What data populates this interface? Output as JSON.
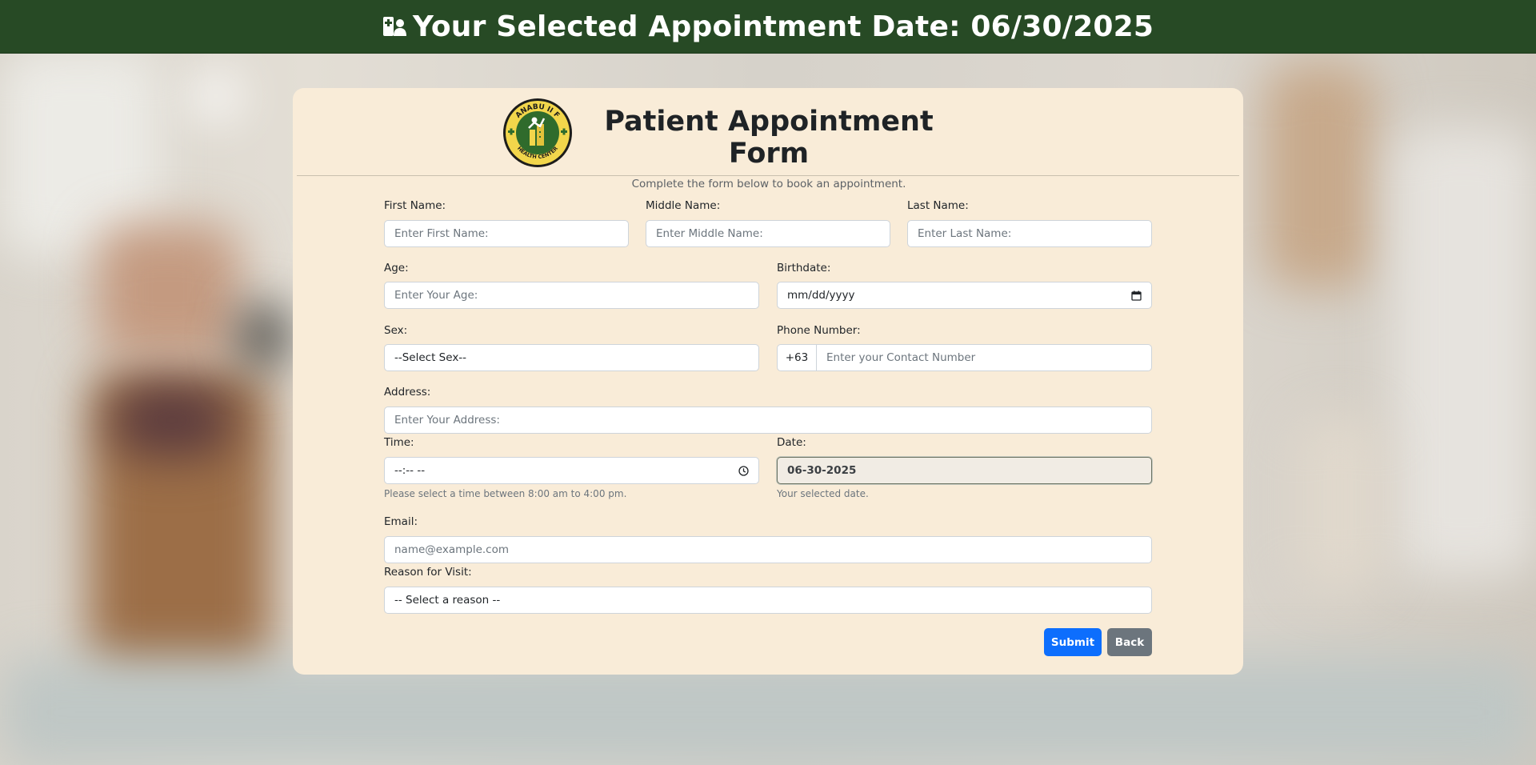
{
  "header": {
    "title": "Your Selected Appointment Date: 06/30/2025",
    "icon": "hospital-user-icon",
    "background": "#274a25"
  },
  "form": {
    "title": "Patient Appointment Form",
    "subtitle": "Complete the form below to book an appointment.",
    "logo": {
      "ring_top": "ANABU II F",
      "ring_bottom": "HEALTH CENTER"
    },
    "first_name": {
      "label": "First Name:",
      "placeholder": "Enter First Name:"
    },
    "middle_name": {
      "label": "Middle Name:",
      "placeholder": "Enter Middle Name:"
    },
    "last_name": {
      "label": "Last Name:",
      "placeholder": "Enter Last Name:"
    },
    "age": {
      "label": "Age:",
      "placeholder": "Enter Your Age:"
    },
    "birthdate": {
      "label": "Birthdate:",
      "value": "mm/dd/yyyy",
      "icon": "calendar-icon"
    },
    "sex": {
      "label": "Sex:",
      "value": "--Select Sex--"
    },
    "phone": {
      "label": "Phone Number:",
      "prefix": "+63",
      "placeholder": "Enter your Contact Number"
    },
    "address": {
      "label": "Address:",
      "placeholder": "Enter Your Address:"
    },
    "time": {
      "label": "Time:",
      "value": "--:-- --",
      "help": "Please select a time between 8:00 am to 4:00 pm.",
      "icon": "clock-icon"
    },
    "date": {
      "label": "Date:",
      "value": "06-30-2025",
      "help": "Your selected date."
    },
    "email": {
      "label": "Email:",
      "placeholder": "name@example.com"
    },
    "reason": {
      "label": "Reason for Visit:",
      "value": "-- Select a reason --"
    },
    "submit_label": "Submit",
    "back_label": "Back"
  },
  "colors": {
    "card": "#f9ecd8",
    "primary": "#0d6efd",
    "secondary": "#6c757d"
  }
}
